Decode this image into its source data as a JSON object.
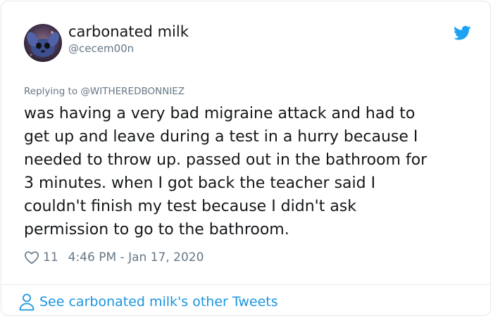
{
  "tweet": {
    "author_name": "carbonated milk",
    "author_handle": "@cecem00n",
    "reply_prefix": "Replying to",
    "reply_to": "@WITHEREDBONNIEZ",
    "text": "was having a very bad migraine attack and had to\nget up and leave during a test in a hurry because I\nneeded to throw up. passed out in the bathroom for\n3 minutes. when I got back the teacher said I\ncouldn't finish my test because I didn't ask\npermission to go to the bathroom.",
    "likes": "11",
    "timestamp": "4:46 PM - Jan 17, 2020"
  },
  "footer": {
    "link_text": "See carbonated milk's other Tweets"
  },
  "colors": {
    "brand_blue": "#1da1f2",
    "link_blue": "#1b95e0",
    "secondary_text": "#657786"
  },
  "icons": {
    "logo": "twitter-bird-icon",
    "like": "heart-outline-icon",
    "profile": "person-outline-icon"
  }
}
